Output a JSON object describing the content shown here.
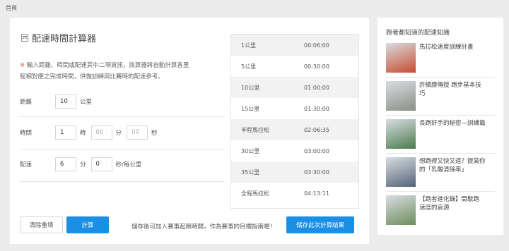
{
  "breadcrumb": "首頁",
  "calculator": {
    "title": "配速時間計算器",
    "note_mark": "※",
    "note_line1": "輸入距離、時間或配速其中二項資訊，換算器將自動計算各里",
    "note_line2": "程相對應之完成時間，供做訓練與比賽時的配速參考。",
    "distance": {
      "label": "距離",
      "value": "10",
      "unit": "公里"
    },
    "time": {
      "label": "時間",
      "hours": "1",
      "hours_unit": "時",
      "minutes_placeholder": "00",
      "minutes_unit": "分",
      "seconds_placeholder": "00",
      "seconds_unit": "秒"
    },
    "pace": {
      "label": "配速",
      "minutes": "6",
      "minutes_unit": "分",
      "seconds": "0",
      "seconds_unit": "秒/每公里"
    },
    "clear_button": "清除重填",
    "calc_button": "計算",
    "save_hint": "儲存後可加入賽事起跑時間，作為賽事的目標指南喔！",
    "save_button": "儲存此次計算結果"
  },
  "results": [
    {
      "distance": "1公里",
      "time": "00:06:00"
    },
    {
      "distance": "5公里",
      "time": "00:30:00"
    },
    {
      "distance": "10公里",
      "time": "01:00:00"
    },
    {
      "distance": "15公里",
      "time": "01:30:00"
    },
    {
      "distance": "半程馬拉松",
      "time": "02:06:35"
    },
    {
      "distance": "30公里",
      "time": "03:00:00"
    },
    {
      "distance": "35公里",
      "time": "03:30:00"
    },
    {
      "distance": "全程馬拉松",
      "time": "04:13:11"
    }
  ],
  "sidebar": {
    "title": "跑者都知道的配速知識",
    "articles": [
      {
        "lines": [
          "馬拉松速度訓練計畫"
        ],
        "thumb_color": "#c94a2e"
      },
      {
        "lines": [
          "許績勝傳授 跑步基本技",
          "巧"
        ],
        "thumb_color": "#8a8f86"
      },
      {
        "lines": [
          "長跑好手的秘密—訓練篇"
        ],
        "thumb_color": "#4a7a4c"
      },
      {
        "lines": [
          "想跑得又快又遠？提高你",
          "的「乳酸清除率」"
        ],
        "thumb_color": "#556477"
      },
      {
        "lines": [
          "【跑者進化錄】間歇跑",
          "速度的哀源"
        ],
        "thumb_color": "#6d8c5a"
      }
    ]
  }
}
